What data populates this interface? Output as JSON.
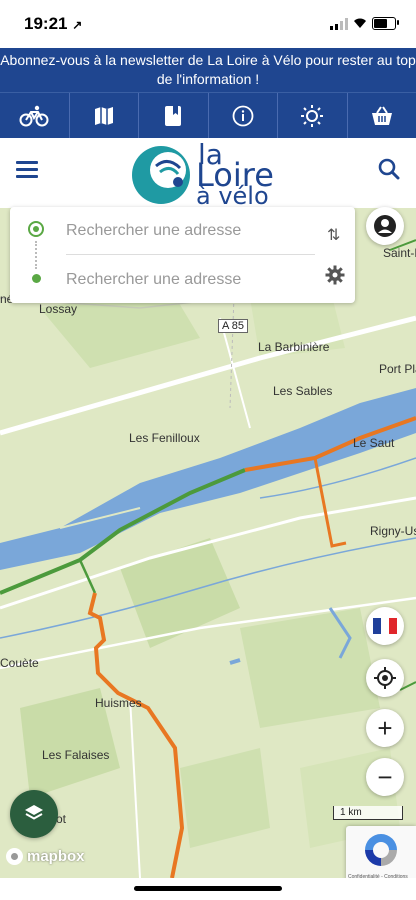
{
  "status_bar": {
    "time": "19:21",
    "location_arrow": "↗"
  },
  "banner": {
    "text": "Abonnez-vous à la newsletter de La Loire à Vélo pour rester au top de l'information !"
  },
  "toolbar": {
    "icons": [
      "bicycle-icon",
      "map-icon",
      "bookmark-book-icon",
      "info-icon",
      "sun-icon",
      "basket-icon"
    ]
  },
  "header": {
    "logo": {
      "line1": "la",
      "line2": "Loire",
      "line3": "à vélo"
    }
  },
  "search_panel": {
    "from_placeholder": "Rechercher une adresse",
    "to_placeholder": "Rechercher une adresse",
    "swap_glyph": "⇅"
  },
  "map": {
    "road_label": "A 85",
    "places": {
      "saint": "Saint-R",
      "lossay": "Lossay",
      "barbiniere": "La Barbinière",
      "port": "Port Pla",
      "sables": "Les Sables",
      "fenilloux": "Les Fenilloux",
      "saut": "Le Saut",
      "rigny": "Rigny-Us",
      "coueste": "Couète",
      "huismes": "Huismes",
      "falaises": "Les Falaises",
      "ot": "ot",
      "ne": "né"
    },
    "scale_label": "1 km",
    "attribution": "mapbox"
  },
  "controls": {
    "zoom_in": "+",
    "zoom_out": "−",
    "language_flag": "fr-flag"
  },
  "recaptcha": {
    "text": "Confidentialité - Conditions"
  },
  "colors": {
    "brand_blue": "#1f4690",
    "route_green": "#4c9a3c",
    "route_orange": "#e87722",
    "river": "#7aa7d9",
    "map_bg": "#dfe8c4"
  }
}
